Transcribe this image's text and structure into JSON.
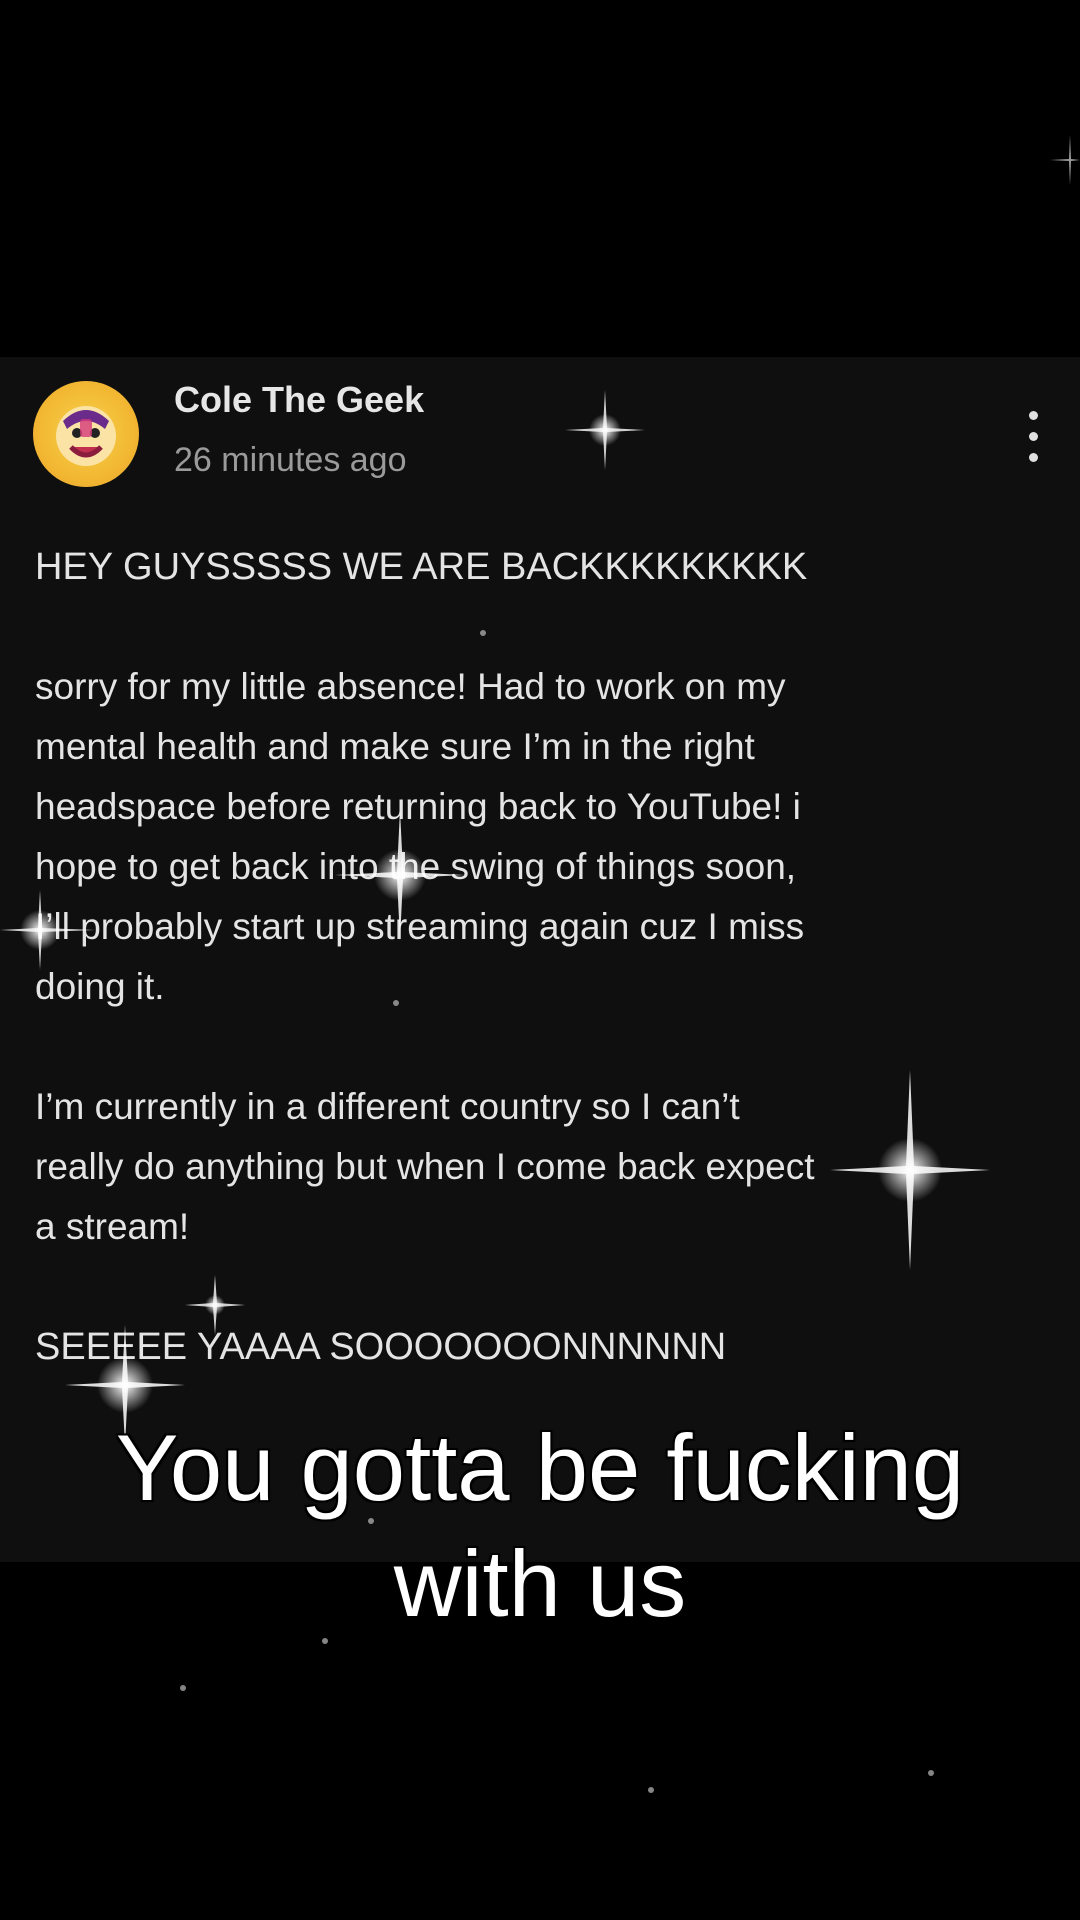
{
  "post": {
    "author": "Cole The Geek",
    "timestamp": "26 minutes ago",
    "more_icon": "more-vertical-icon",
    "avatar_icon": "cartoon-avatar-icon",
    "body": {
      "line1": "HEY GUYSSSSS WE ARE BACKKKKKKKKK",
      "line2": "sorry for my little absence! Had to work on my",
      "line3": "mental health and make sure I’m in the right",
      "line4": "headspace before returning back to YouTube! i",
      "line5": "hope to get back into the swing of things soon,",
      "line6": "I’ll probably start up streaming again cuz I miss",
      "line7": "doing it.",
      "line8": "I’m currently in a different country so I can’t",
      "line9": "really do anything but when I come back expect",
      "line10": "a stream!",
      "line11": "SEEEEE YAAAA SOOOOOOONNNNNN"
    }
  },
  "caption": {
    "line1": "You gotta be fucking",
    "line2": "with us"
  },
  "colors": {
    "background": "#000000",
    "card": "#0f0f0f",
    "text": "#e4e4e4",
    "muted": "#9a9a9a"
  }
}
